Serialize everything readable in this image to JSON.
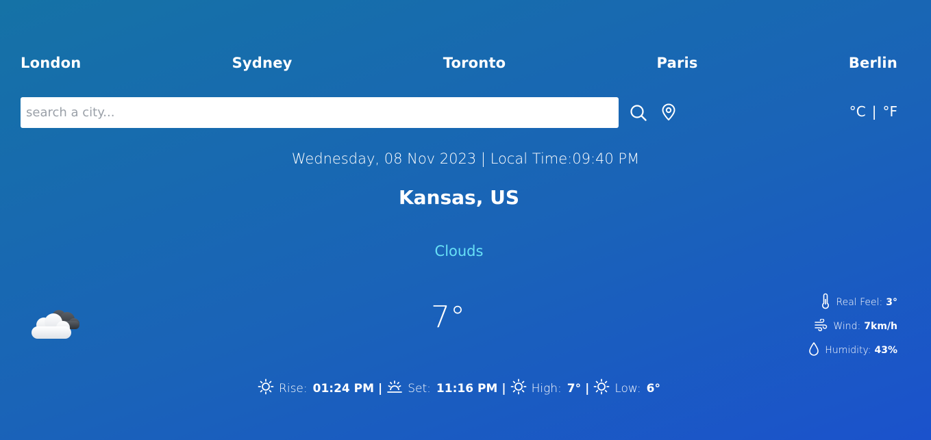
{
  "cities": [
    "London",
    "Sydney",
    "Toronto",
    "Paris",
    "Berlin"
  ],
  "search": {
    "placeholder": "search a city..."
  },
  "icons": {
    "search": "search-icon",
    "location": "map-pin-icon",
    "weather": "clouds-icon",
    "real_feel": "thermometer-icon",
    "wind": "wind-icon",
    "humidity": "droplet-icon",
    "sunrise": "sun-icon",
    "sunset": "sunset-icon"
  },
  "units": {
    "celsius": "°C",
    "separator": "|",
    "fahrenheit": "°F"
  },
  "datetime": "Wednesday, 08 Nov 2023 | Local Time:09:40 PM",
  "location": "Kansas, US",
  "condition": "Clouds",
  "temperature": "7°",
  "details": {
    "real_feel_label": "Real Feel:",
    "real_feel_value": "3°",
    "wind_label": "Wind:",
    "wind_value": "7km/h",
    "humidity_label": "Humidity:",
    "humidity_value": "43%"
  },
  "sun": {
    "rise_label": "Rise:",
    "rise_value": "01:24 PM",
    "set_label": "Set:",
    "set_value": "11:16 PM",
    "high_label": "High:",
    "high_value": "7°",
    "low_label": "Low:",
    "low_value": "6°",
    "separator": "|"
  },
  "colors": {
    "condition_text": "#67e0f6",
    "background_start": "#1572a6",
    "background_end": "#1b52cc"
  }
}
